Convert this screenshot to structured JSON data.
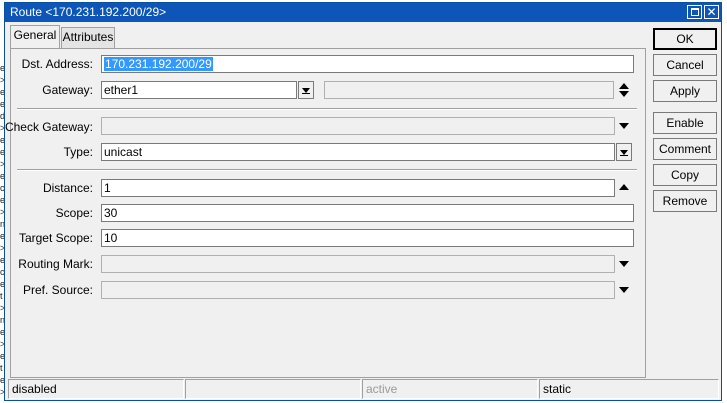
{
  "window": {
    "title": "Route <170.231.192.200/29>"
  },
  "tabs": [
    {
      "label": "General"
    },
    {
      "label": "Attributes"
    }
  ],
  "form": {
    "dst_address": {
      "label": "Dst. Address:",
      "value": "170.231.192.200/29"
    },
    "gateway": {
      "label": "Gateway:",
      "value": "ether1",
      "value2": ""
    },
    "check_gateway": {
      "label": "Check Gateway:",
      "value": ""
    },
    "type": {
      "label": "Type:",
      "value": "unicast"
    },
    "distance": {
      "label": "Distance:",
      "value": "1"
    },
    "scope": {
      "label": "Scope:",
      "value": "30"
    },
    "target_scope": {
      "label": "Target Scope:",
      "value": "10"
    },
    "routing_mark": {
      "label": "Routing Mark:",
      "value": ""
    },
    "pref_source": {
      "label": "Pref. Source:",
      "value": ""
    }
  },
  "buttons": {
    "ok": "OK",
    "cancel": "Cancel",
    "apply": "Apply",
    "enable": "Enable",
    "comment": "Comment",
    "copy": "Copy",
    "remove": "Remove"
  },
  "status": {
    "state": "disabled",
    "empty": "",
    "active": "active",
    "kind": "static"
  },
  "colors": {
    "titlebar": "#0d56b7",
    "selection": "#3399ff",
    "window_bg": "#f0f0f0"
  }
}
